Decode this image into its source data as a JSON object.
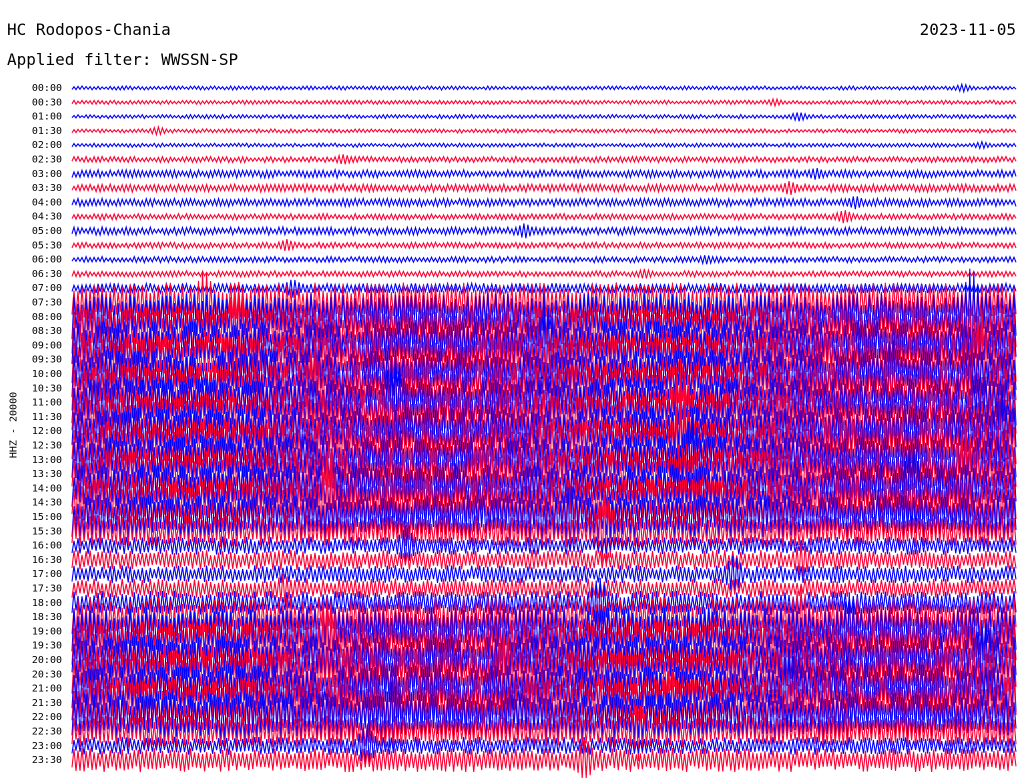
{
  "header": {
    "station": "HC Rodopos-Chania",
    "date": "2023-11-05",
    "filter": "Applied filter: WWSSN-SP"
  },
  "chart_data": {
    "type": "line",
    "title": "HC Rodopos-Chania",
    "ylabel": "HHZ - 20000",
    "colors": {
      "even": "#0000ff",
      "odd": "#ff0033"
    },
    "tick_labels": [
      "00:00",
      "00:30",
      "01:00",
      "01:30",
      "02:00",
      "02:30",
      "03:00",
      "03:30",
      "04:00",
      "04:30",
      "05:00",
      "05:30",
      "06:00",
      "06:30",
      "07:00",
      "07:30",
      "08:00",
      "08:30",
      "09:00",
      "09:30",
      "10:00",
      "10:30",
      "11:00",
      "11:30",
      "12:00",
      "12:30",
      "13:00",
      "13:30",
      "14:00",
      "14:30",
      "15:00",
      "15:30",
      "16:00",
      "16:30",
      "17:00",
      "17:30",
      "18:00",
      "18:30",
      "19:00",
      "19:30",
      "20:00",
      "20:30",
      "21:00",
      "21:30",
      "22:00",
      "22:30",
      "23:00",
      "23:30"
    ],
    "series_amplitude": [
      2,
      2,
      2,
      2,
      2,
      3,
      4,
      4,
      4,
      3,
      4,
      3,
      3,
      3,
      5,
      20,
      24,
      24,
      24,
      24,
      24,
      24,
      24,
      24,
      24,
      24,
      24,
      24,
      24,
      24,
      22,
      16,
      9,
      10,
      9,
      10,
      12,
      20,
      24,
      24,
      24,
      24,
      24,
      24,
      24,
      16,
      9,
      12
    ]
  }
}
